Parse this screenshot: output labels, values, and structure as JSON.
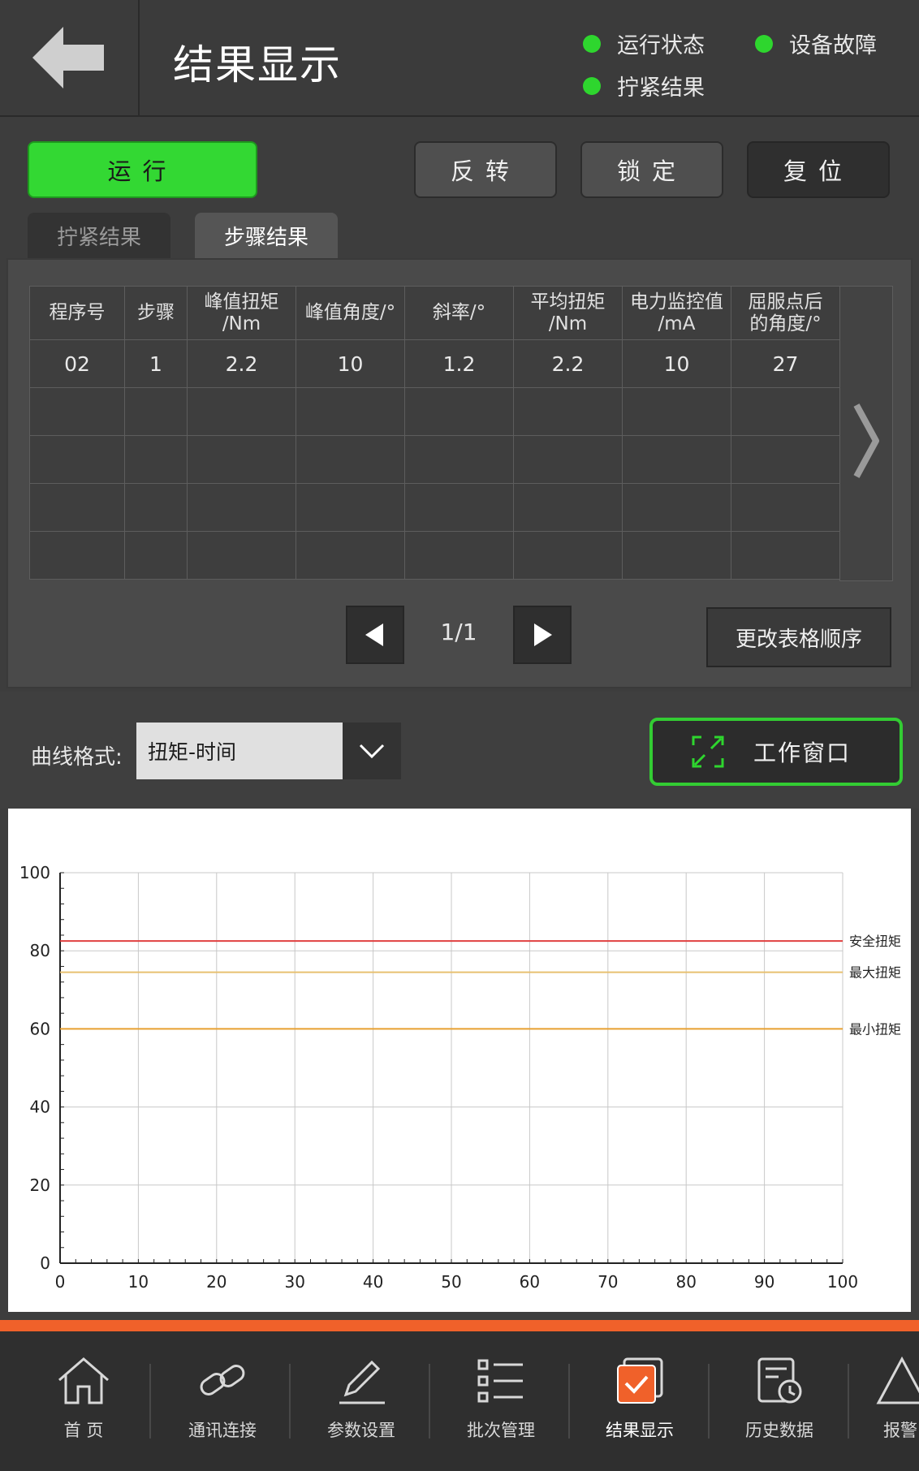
{
  "header": {
    "title": "结果显示",
    "status": [
      {
        "label": "运行状态",
        "color": "#2ed62e"
      },
      {
        "label": "设备故障",
        "color": "#2ed62e"
      },
      {
        "label": "拧紧结果",
        "color": "#2ed62e"
      }
    ]
  },
  "controls": {
    "run": "运行",
    "reverse": "反转",
    "lock": "锁定",
    "reset": "复位"
  },
  "tabs": [
    {
      "label": "拧紧结果",
      "active": false
    },
    {
      "label": "步骤结果",
      "active": true
    }
  ],
  "table": {
    "headers": [
      "程序号",
      "步骤",
      "峰值扭矩\n/Nm",
      "峰值角度/°",
      "斜率/°",
      "平均扭矩\n/Nm",
      "电力监控值\n/mA",
      "屈服点后\n的角度/°"
    ],
    "rows": [
      [
        "02",
        "1",
        "2.2",
        "10",
        "1.2",
        "2.2",
        "10",
        "27"
      ],
      [
        "",
        "",
        "",
        "",
        "",
        "",
        "",
        ""
      ],
      [
        "",
        "",
        "",
        "",
        "",
        "",
        "",
        ""
      ],
      [
        "",
        "",
        "",
        "",
        "",
        "",
        "",
        ""
      ],
      [
        "",
        "",
        "",
        "",
        "",
        "",
        "",
        ""
      ]
    ]
  },
  "pager": {
    "page": "1/1"
  },
  "order_button": "更改表格顺序",
  "curve": {
    "label": "曲线格式:",
    "selected": "扭矩-时间",
    "work_window": "工作窗口"
  },
  "chart_data": {
    "type": "line",
    "xlim": [
      0,
      100
    ],
    "ylim": [
      0,
      100
    ],
    "x_ticks": [
      0,
      10,
      20,
      30,
      40,
      50,
      60,
      70,
      80,
      90,
      100
    ],
    "y_ticks": [
      0,
      20,
      40,
      60,
      80,
      100
    ],
    "grid": true,
    "reference_lines": [
      {
        "name": "安全扭矩",
        "y": 82.5,
        "color": "#e04040"
      },
      {
        "name": "最大扭矩",
        "y": 74.5,
        "color": "#e8c070"
      },
      {
        "name": "最小扭矩",
        "y": 60,
        "color": "#e8a030"
      }
    ],
    "series": []
  },
  "nav": [
    {
      "label": "首 页",
      "icon": "home-icon",
      "active": false
    },
    {
      "label": "通讯连接",
      "icon": "link-icon",
      "active": false
    },
    {
      "label": "参数设置",
      "icon": "pencil-icon",
      "active": false
    },
    {
      "label": "批次管理",
      "icon": "list-icon",
      "active": false
    },
    {
      "label": "结果显示",
      "icon": "result-icon",
      "active": true
    },
    {
      "label": "历史数据",
      "icon": "history-icon",
      "active": false
    },
    {
      "label": "报警",
      "icon": "alarm-icon",
      "active": false
    }
  ]
}
